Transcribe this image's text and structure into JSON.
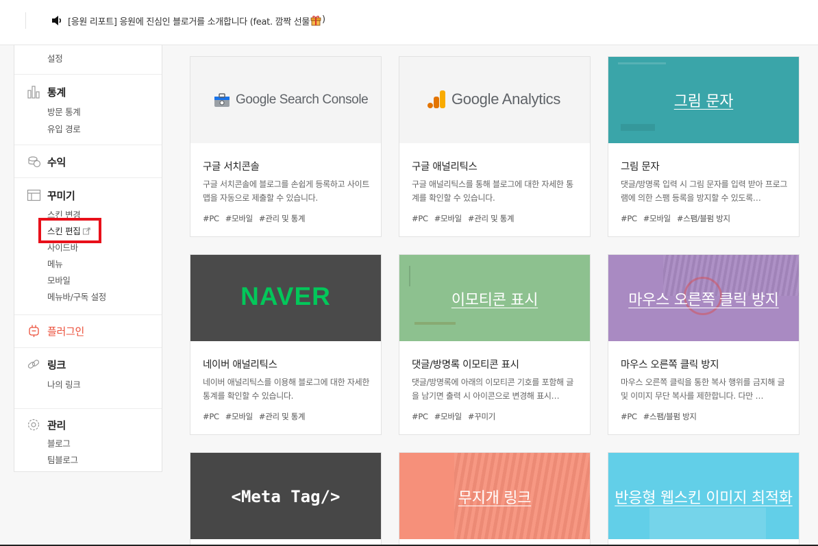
{
  "notice": {
    "text": "[응원 리포트] 응원에 진심인 블로거를 소개합니다 (feat. 깜짝 선물 ",
    "close": ")"
  },
  "sidebar": {
    "settings_label": "설정",
    "stats": {
      "label": "통계",
      "items": [
        "방문 통계",
        "유입 경로"
      ]
    },
    "revenue": {
      "label": "수익"
    },
    "decorate": {
      "label": "꾸미기",
      "items": [
        "스킨 변경",
        "스킨 편집",
        "사이드바",
        "메뉴",
        "모바일",
        "메뉴바/구독 설정"
      ]
    },
    "plugin": {
      "label": "플러그인"
    },
    "link": {
      "label": "링크",
      "items": [
        "나의 링크"
      ]
    },
    "manage": {
      "label": "관리",
      "items": [
        "블로그",
        "팀블로그"
      ]
    }
  },
  "cards": [
    {
      "thumb_text": "Google Search Console",
      "title": "구글 서치콘솔",
      "desc": "구글 서치콘솔에 블로그를 손쉽게 등록하고 사이트맵을 자동으로 제출할 수 있습니다.",
      "tags": [
        "#PC",
        "#모바일",
        "#관리 및 통계"
      ]
    },
    {
      "thumb_text": "Google Analytics",
      "title": "구글 애널리틱스",
      "desc": "구글 애널리틱스를 통해 블로그에 대한 자세한 통계를 확인할 수 있습니다.",
      "tags": [
        "#PC",
        "#모바일",
        "#관리 및 통계"
      ]
    },
    {
      "thumb_text": "그림 문자",
      "title": "그림 문자",
      "desc": "댓글/방명록 입력 시 그림 문자를 입력 받아 프로그램에 의한 스팸 등록을 방지할 수 있도록…",
      "tags": [
        "#PC",
        "#모바일",
        "#스팸/블펌 방지"
      ]
    },
    {
      "thumb_text": "NAVER",
      "title": "네이버 애널리틱스",
      "desc": "네이버 애널리틱스를 이용해 블로그에 대한 자세한 통계를 확인할 수 있습니다.",
      "tags": [
        "#PC",
        "#모바일",
        "#관리 및 통계"
      ]
    },
    {
      "thumb_text": "이모티콘 표시",
      "title": "댓글/방명록 이모티콘 표시",
      "desc": "댓글/방명록에 아래의 이모티콘 기호를 포함해 글을 남기면 출력 시 아이콘으로 변경해 표시…",
      "tags": [
        "#PC",
        "#모바일",
        "#꾸미기"
      ]
    },
    {
      "thumb_text": "마우스 오른쪽 클릭 방지",
      "title": "마우스 오른쪽 클릭 방지",
      "desc": "마우스 오른쪽 클릭을 통한 복사 행위를 금지해 글 및 이미지 무단 복사를 제한합니다. 다만 …",
      "tags": [
        "#PC",
        "#스팸/블펌 방지"
      ]
    },
    {
      "thumb_text": "<Meta Tag/>"
    },
    {
      "thumb_text": "무지개 링크"
    },
    {
      "thumb_text": "반응형 웹스킨 이미지 최적화"
    }
  ],
  "colors": {
    "accent_red": "#eb4e39",
    "highlight_box": "#e8101a",
    "naver_green": "#03c75a"
  }
}
